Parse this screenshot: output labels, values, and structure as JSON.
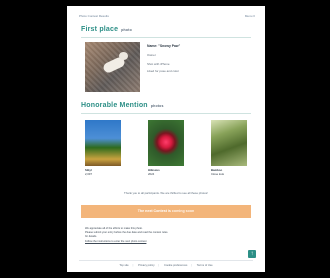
{
  "topbar": {
    "breadcrumb": "Photo Contest Results",
    "menu": "Menu ≡"
  },
  "first": {
    "title": "First place",
    "subtitle": "photo",
    "winner_name": "Name: \"Snowy Paw\"",
    "line1": "Owner",
    "line2": "Shot with iPhone",
    "line3": "Liked for pose and color"
  },
  "honorable": {
    "title": "Honorable Mention",
    "subtitle": "photos",
    "items": [
      {
        "name": "Sibyl",
        "desc": "2,097"
      },
      {
        "name": "Hibiscus",
        "desc": "2024"
      },
      {
        "name": "Bamboo",
        "desc": "Close look"
      }
    ]
  },
  "thanks": "Thank you to all participants. We are thrilled to see all these photos!",
  "banner": {
    "text": "The next Contest is",
    "highlight": "coming soon"
  },
  "notes": {
    "line1": "We appreciate all of the efforts to make this photo.",
    "line2": "Please submit your entry before the due date and read the contest rules.",
    "line3": "for details.",
    "link": "Follow the instructions to enter the next photo contest"
  },
  "fab_icon": "↑",
  "footer": {
    "links": [
      "Top site",
      "Privacy policy",
      "Cookie preferences",
      "Terms of Use"
    ]
  }
}
